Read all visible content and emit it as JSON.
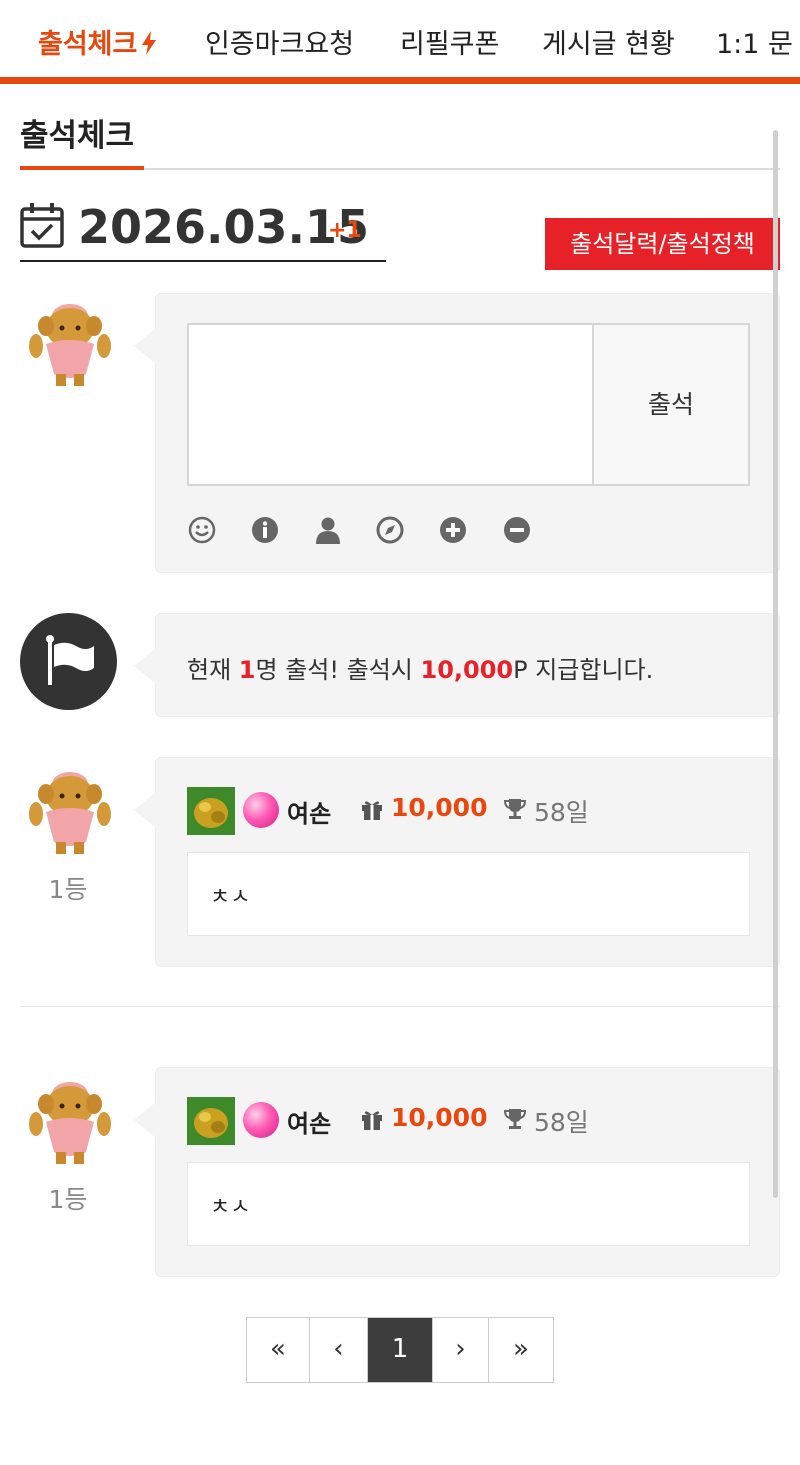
{
  "nav": {
    "items": [
      "출석체크",
      "인증마크요청",
      "리필쿠폰",
      "게시글 현황",
      "1:1 문"
    ]
  },
  "section": {
    "title": "출석체크"
  },
  "date": {
    "value": "2026.03.15",
    "plus": "+1"
  },
  "policy_button": "출석달력/출석정책",
  "comment": {
    "submit_label": "출석",
    "value": ""
  },
  "notice": {
    "prefix": "현재 ",
    "count": "1",
    "middle": "명 출석! 출석시 ",
    "points": "10,000",
    "suffix": "P 지급합니다."
  },
  "entries": [
    {
      "rank": "1등",
      "name": "여손",
      "points": "10,000",
      "days": "58일",
      "message": "ㅊㅅ"
    },
    {
      "rank": "1등",
      "name": "여손",
      "points": "10,000",
      "days": "58일",
      "message": "ㅊㅅ"
    }
  ],
  "pagination": {
    "first": "«",
    "prev": "‹",
    "current": "1",
    "next": "›",
    "last": "»"
  },
  "colors": {
    "accent": "#e8470d",
    "red": "#e62128",
    "dark": "#333333"
  },
  "icons": [
    "bolt-icon",
    "calendar-icon",
    "smile-icon",
    "info-icon",
    "user-icon",
    "compass-icon",
    "plus-icon",
    "minus-icon",
    "flag-icon",
    "level-icon",
    "gift-icon",
    "trophy-icon"
  ]
}
